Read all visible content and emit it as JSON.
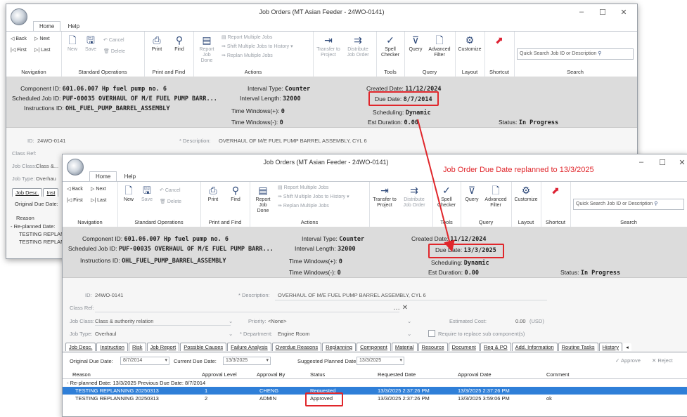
{
  "window1": {
    "title": "Job Orders (MT Asian Feeder - 24WO-0141)",
    "tabs": [
      "Home",
      "Help"
    ],
    "header": {
      "component": "Component ID: ",
      "component_v": "601.06.007 Hp fuel pump no. 6",
      "scheduled": "Scheduled Job ID: ",
      "scheduled_v": "PUF-00035 OVERHAUL OF M/E FUEL PUMP BARR...",
      "instructions": "Instructions ID: ",
      "instructions_v": "OHL_FUEL_PUMP_BARREL_ASSEMBLY",
      "interval_type": "Interval Type: ",
      "interval_type_v": "Counter",
      "interval_length": "Interval Length: ",
      "interval_length_v": "32000",
      "tw_plus": "Time Windows(+): ",
      "tw_plus_v": "0",
      "tw_minus": "Time Windows(-): ",
      "tw_minus_v": "0",
      "created": "Created Date: ",
      "created_v": "11/12/2024",
      "due": "Due Date: ",
      "due_v": "8/7/2014",
      "scheduling": "Scheduling: ",
      "scheduling_v": "Dynamic",
      "est": "Est Duration: ",
      "est_v": "0.00",
      "status": "Status: ",
      "status_v": "In Progress"
    },
    "form": {
      "id_label": "ID:",
      "id_value": "24WO-0141",
      "desc_label": "* Description:",
      "desc_value": "OVERHAUL OF M/E FUEL PUMP BARREL ASSEMBLY, CYL 6",
      "classref": "Class Ref:",
      "jobclass": "Job Class:",
      "jobclass_v": "Class &...",
      "jobtype": "Job Type:",
      "jobtype_v": "Overhau",
      "tab1": "Job Desc.",
      "tab2": "Inst",
      "orig_due": "Original Due Date:",
      "reason": "Reason",
      "replanned": "- Re-planned Date:",
      "row1": "TESTING REPLAN",
      "row2": "TESTING REPLAN"
    }
  },
  "window2": {
    "title": "Job Orders (MT Asian Feeder - 24WO-0141)",
    "tabs": [
      "Home",
      "Help"
    ],
    "header": {
      "component": "Component ID: ",
      "component_v": "601.06.007 Hp fuel pump no. 6",
      "scheduled": "Scheduled Job ID: ",
      "scheduled_v": "PUF-00035 OVERHAUL OF M/E FUEL PUMP BARR...",
      "instructions": "Instructions ID: ",
      "instructions_v": "OHL_FUEL_PUMP_BARREL_ASSEMBLY",
      "interval_type": "Interval Type: ",
      "interval_type_v": "Counter",
      "interval_length": "Interval Length: ",
      "interval_length_v": "32000",
      "tw_plus": "Time Windows(+): ",
      "tw_plus_v": "0",
      "tw_minus": "Time Windows(-): ",
      "tw_minus_v": "0",
      "created": "Created Date: ",
      "created_v": "11/12/2024",
      "due": "Due Date: ",
      "due_v": "13/3/2025",
      "scheduling": "Scheduling: ",
      "scheduling_v": "Dynamic",
      "est": "Est Duration: ",
      "est_v": "0.00",
      "status": "Status: ",
      "status_v": "In Progress"
    },
    "form": {
      "id_label": "ID:",
      "id_value": "24WO-0141",
      "desc_label": "* Description:",
      "desc_value": "OVERHAUL OF M/E FUEL PUMP BARREL ASSEMBLY, CYL 6",
      "classref": "Class Ref:",
      "jobclass": "Job Class:",
      "jobclass_v": "Class & authority relation",
      "priority": "Priority:",
      "priority_v": "<None>",
      "est_cost": "Estimated Cost:",
      "est_cost_v": "0.00",
      "usd": "(USD)",
      "jobtype": "Job Type:",
      "jobtype_v": "Overhaul",
      "department": "* Department:",
      "department_v": "Engine Room",
      "require": "Require to replace sub component(s)"
    },
    "subtabs": [
      "Job Desc.",
      "Instruction",
      "Risk",
      "Job Report",
      "Possible Causes",
      "Failure Analysis",
      "Overdue Reasons",
      "Replanning",
      "Component",
      "Material",
      "Resource",
      "Document",
      "Reg & PO",
      "Add. Information",
      "Routine Tasks",
      "History"
    ],
    "replan": {
      "orig_label": "Original Due Date:",
      "orig_v": "8/7/2014",
      "curr_label": "Current Due Date:",
      "curr_v": "13/3/2025",
      "sugg_label": "Suggested Planned Date:",
      "sugg_v": "13/3/2025",
      "approve": "Approve",
      "reject": "Reject",
      "columns": [
        "Reason",
        "Approval Level",
        "Approval By",
        "Status",
        "Requested Date",
        "Approval Date",
        "Comment"
      ],
      "group": "- Re-planned Date: 13/3/2025   Previous Due Date: 8/7/2014",
      "rows": [
        [
          "TESTING REPLANNING 20250313",
          "1",
          "CHENG",
          "Requested",
          "13/3/2025 2:37:26 PM",
          "13/3/2025 2:37:26 PM",
          ""
        ],
        [
          "TESTING REPLANNING 20250313",
          "2",
          "ADMIN",
          "Approved",
          "13/3/2025 2:37:26 PM",
          "13/3/2025 3:59:06 PM",
          "ok"
        ]
      ]
    }
  },
  "ribbon": {
    "back": "Back",
    "next": "Next",
    "first": "First",
    "last": "Last",
    "navigation": "Navigation",
    "new": "New",
    "save": "Save",
    "cancel": "Cancel",
    "delete": "Delete",
    "standard_ops": "Standard Operations",
    "print": "Print",
    "find": "Find",
    "print_find": "Print and Find",
    "report_job": "Report Job",
    "done": "Done",
    "report_multiple": "Report Multiple Jobs",
    "shift_multiple": "Shift Multiple Jobs to History",
    "replan_multiple": "Replan Multiple Jobs",
    "actions": "Actions",
    "transfer_to": "Transfer to",
    "project": "Project",
    "distribute": "Distribute",
    "job_order": "Job Order",
    "spell": "Spell",
    "checker": "Checker",
    "tools": "Tools",
    "query": "Query",
    "advanced": "Advanced",
    "filter": "Filter",
    "query_grp": "Query",
    "customize": "Customize",
    "layout": "Layout",
    "shortcut": "Shortcut",
    "quick_search": "Quick Search Job ID or Description",
    "search": "Search"
  },
  "annotation": "Job Order Due Date replanned to 13/3/2025",
  "colors": {
    "highlight_red": "#e0262b",
    "selection_blue": "#2f7fd8",
    "header_bg": "#dcdcdc"
  }
}
